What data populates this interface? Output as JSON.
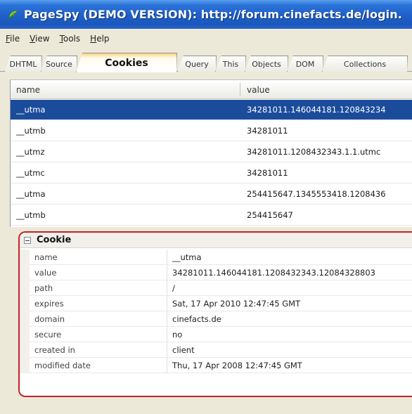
{
  "window": {
    "title": "PageSpy (DEMO VERSION): http://forum.cinefacts.de/login."
  },
  "menu": {
    "items": [
      "File",
      "View",
      "Tools",
      "Help"
    ]
  },
  "tabs": {
    "items": [
      "DHTML",
      "Source",
      "Cookies",
      "Query",
      "This",
      "Objects",
      "DOM",
      "Collections"
    ],
    "active": "Cookies"
  },
  "cookies_table": {
    "columns": [
      "name",
      "value"
    ],
    "rows": [
      {
        "name": "__utma",
        "value": "34281011.146044181.120843234"
      },
      {
        "name": "__utmb",
        "value": "34281011"
      },
      {
        "name": "__utmz",
        "value": "34281011.1208432343.1.1.utmc"
      },
      {
        "name": "__utmc",
        "value": "34281011"
      },
      {
        "name": "__utma",
        "value": "254415647.1345553418.1208436"
      },
      {
        "name": "__utmb",
        "value": "254415647"
      }
    ],
    "selected_index": 0
  },
  "cookie_details": {
    "title": "Cookie",
    "properties": [
      {
        "name": "name",
        "value": "__utma"
      },
      {
        "name": "value",
        "value": "34281011.146044181.1208432343.12084328803"
      },
      {
        "name": "path",
        "value": "/"
      },
      {
        "name": "expires",
        "value": "Sat, 17 Apr 2010 12:47:45 GMT"
      },
      {
        "name": "domain",
        "value": "cinefacts.de"
      },
      {
        "name": "secure",
        "value": "no"
      },
      {
        "name": "created in",
        "value": "client"
      },
      {
        "name": "modified date",
        "value": "Thu, 17 Apr 2008 12:47:45 GMT"
      }
    ]
  },
  "colors": {
    "selection": "#1b4c9c",
    "highlight_border": "#c8202a",
    "titlebar": "#1f5fc8"
  }
}
